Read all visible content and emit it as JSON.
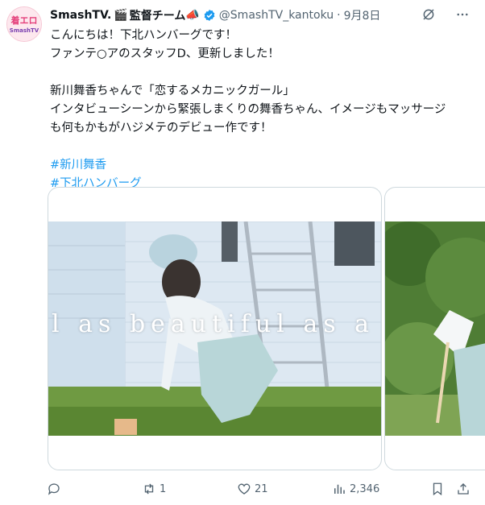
{
  "post": {
    "display_name": "SmashTV.",
    "name_suffix": "監督チーム",
    "clapper_emoji": "🎬",
    "megaphone_emoji": "📣",
    "handle": "@SmashTV_kantoku",
    "separator": "·",
    "date": "9月8日",
    "lines": [
      "こんにちは！下北ハンバーグです！",
      "ファンテ○アのスタッフD、更新しました！",
      "",
      "新川舞香ちゃんで「恋するメカニックガール」",
      "インタビューシーンから緊張しまくりの舞香ちゃん、イメージもマッサージ",
      "も何もかもがハジメテのデビュー作です！",
      "",
      "#新川舞香",
      "#下北ハンバーグ"
    ],
    "hashtags": [
      "#新川舞香",
      "#下北ハンバーグ"
    ]
  },
  "avatar": {
    "text_top": "着エロ",
    "text_bottom": "SmashTV"
  },
  "media": {
    "overlay_text": "l as beautiful as a fl",
    "colors": {
      "sky": "#c8e6f5",
      "wall": "#e8f0f8",
      "grass": "#5d8a35"
    }
  },
  "actions": {
    "reply_count": "",
    "repost_count": "1",
    "like_count": "21",
    "views_count": "2,346"
  },
  "colors": {
    "accent": "#1d9bf0",
    "muted": "#536471",
    "verified": "#1d9bf0"
  }
}
